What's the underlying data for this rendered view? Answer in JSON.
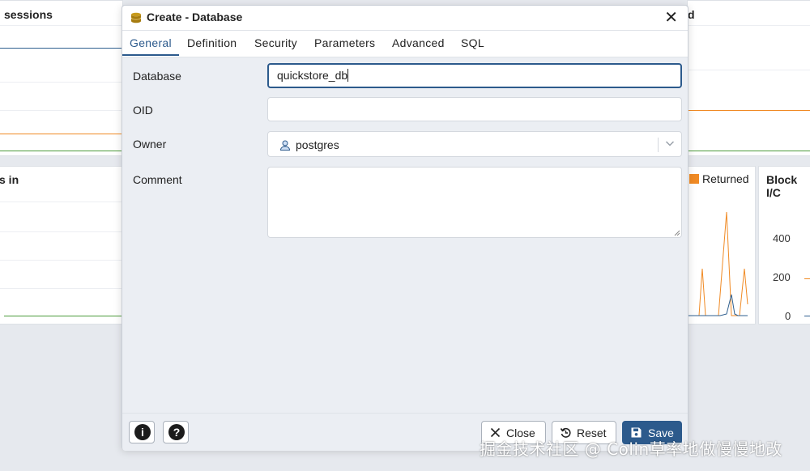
{
  "background": {
    "panel_sessions_title": "sessions",
    "panel_top_right_title": "d",
    "panel_tuples_in_title": "s in",
    "legend_returned": "Returned",
    "panel_blockio_title": "Block I/C",
    "blockio_ticks": [
      "400",
      "200",
      "0"
    ],
    "colors": {
      "orange": "#f08a24",
      "green": "#4c9a3a",
      "blue": "#2f5f8f"
    }
  },
  "dialog": {
    "title": "Create - Database",
    "tabs": [
      {
        "label": "General",
        "active": true
      },
      {
        "label": "Definition"
      },
      {
        "label": "Security"
      },
      {
        "label": "Parameters"
      },
      {
        "label": "Advanced"
      },
      {
        "label": "SQL"
      }
    ],
    "form": {
      "database_label": "Database",
      "database_value": "quickstore_db",
      "oid_label": "OID",
      "oid_value": "",
      "owner_label": "Owner",
      "owner_value": "postgres",
      "comment_label": "Comment",
      "comment_value": ""
    },
    "footer": {
      "info_glyph": "i",
      "help_glyph": "?",
      "close_label": "Close",
      "reset_label": "Reset",
      "save_label": "Save"
    },
    "accent_color": "#2c5a8c"
  },
  "watermark": "掘金技术社区 @ Colin草率地做慢慢地改"
}
